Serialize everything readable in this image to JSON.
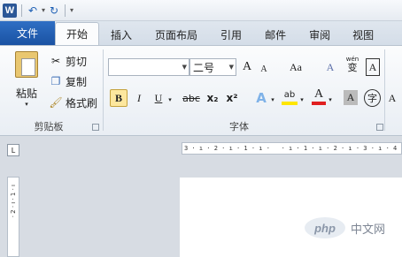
{
  "qat": {
    "app_icon": "W"
  },
  "tabs": [
    {
      "label": "文件"
    },
    {
      "label": "开始"
    },
    {
      "label": "插入"
    },
    {
      "label": "页面布局"
    },
    {
      "label": "引用"
    },
    {
      "label": "邮件"
    },
    {
      "label": "审阅"
    },
    {
      "label": "视图"
    }
  ],
  "clipboard": {
    "paste": "粘贴",
    "cut": "剪切",
    "copy": "复制",
    "format_painter": "格式刷",
    "group": "剪贴板"
  },
  "font": {
    "font_name": "",
    "font_size": "二号",
    "group": "字体",
    "grow": "A",
    "shrink": "A",
    "case": "Aa",
    "clear": "A",
    "phonetic": "wén",
    "phonetic_char": "变",
    "border_char": "A",
    "bold": "B",
    "italic": "I",
    "underline": "U",
    "strike": "abc",
    "subscript": "x₂",
    "superscript": "x²",
    "effects": "A",
    "highlight": "ab",
    "color": "A",
    "shading": "A",
    "enclose": "字",
    "cut_off": "A"
  },
  "ruler": {
    "horizontal": "3 · ı · 2 · ı · 1 · ı ·   · ı · 1 · ı · 2 · ı · 3 · ı · 4",
    "vertical": "· 2 · ı · 1 · ı"
  },
  "watermark": {
    "logo": "php",
    "text": "中文网"
  }
}
